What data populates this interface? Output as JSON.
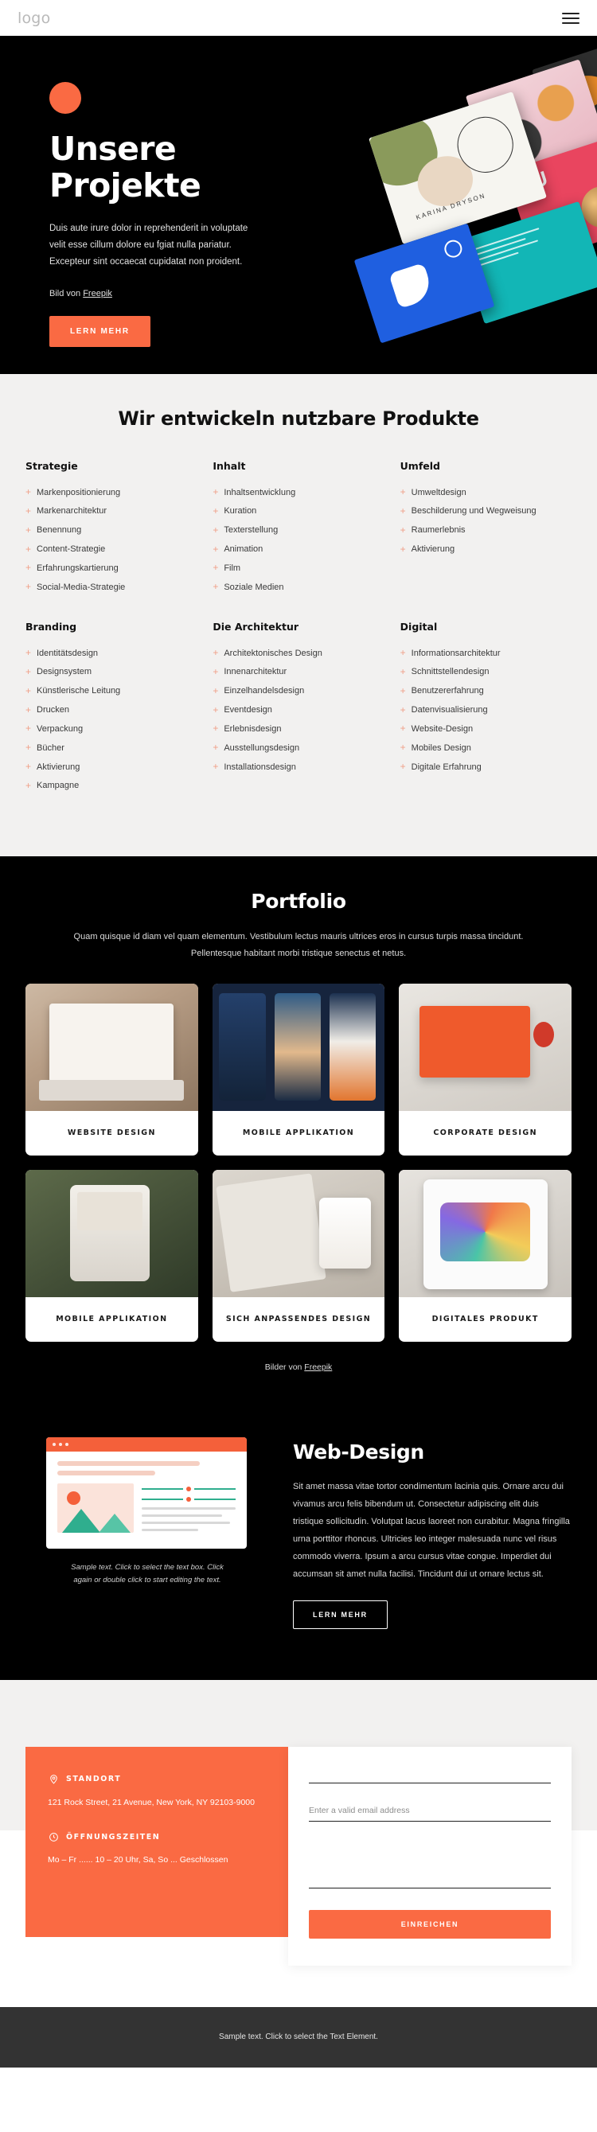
{
  "header": {
    "logo": "logo",
    "menu_icon": "hamburger-menu-icon"
  },
  "hero": {
    "title_line1": "Unsere",
    "title_line2": "Projekte",
    "paragraph": "Duis aute irure dolor in reprehenderit in voluptate velit esse cillum dolore eu fgiat nulla pariatur. Excepteur sint occaecat cupidatat non proident.",
    "credit_prefix": "Bild von ",
    "credit_link": "Freepik",
    "cta_label": "LERN MEHR",
    "accent_color": "#fa6a43",
    "background_color": "#000000"
  },
  "services": {
    "title": "Wir entwickeln nutzbare Produkte",
    "bullet_color": "#f0a088",
    "columns": [
      {
        "heading": "Strategie",
        "items": [
          "Markenpositionierung",
          "Markenarchitektur",
          "Benennung",
          "Content-Strategie",
          "Erfahrungskartierung",
          "Social-Media-Strategie"
        ]
      },
      {
        "heading": "Inhalt",
        "items": [
          "Inhaltsentwicklung",
          "Kuration",
          "Texterstellung",
          "Animation",
          "Film",
          "Soziale Medien"
        ]
      },
      {
        "heading": "Umfeld",
        "items": [
          "Umweltdesign",
          "Beschilderung und Wegweisung",
          "Raumerlebnis",
          "Aktivierung"
        ]
      },
      {
        "heading": "Branding",
        "items": [
          "Identitätsdesign",
          "Designsystem",
          "Künstlerische Leitung",
          "Drucken",
          "Verpackung",
          "Bücher",
          "Aktivierung",
          "Kampagne"
        ]
      },
      {
        "heading": "Die Architektur",
        "items": [
          "Architektonisches Design",
          "Innenarchitektur",
          "Einzelhandelsdesign",
          "Eventdesign",
          "Erlebnisdesign",
          "Ausstellungsdesign",
          "Installationsdesign"
        ]
      },
      {
        "heading": "Digital",
        "items": [
          "Informationsarchitektur",
          "Schnittstellendesign",
          "Benutzererfahrung",
          "Datenvisualisierung",
          "Website-Design",
          "Mobiles Design",
          "Digitale Erfahrung"
        ]
      }
    ]
  },
  "portfolio": {
    "title": "Portfolio",
    "lead": "Quam quisque id diam vel quam elementum. Vestibulum lectus mauris ultrices eros in cursus turpis massa tincidunt. Pellentesque habitant morbi tristique senectus et netus.",
    "cards": [
      {
        "label": "WEBSITE DESIGN"
      },
      {
        "label": "MOBILE APPLIKATION"
      },
      {
        "label": "CORPORATE DESIGN"
      },
      {
        "label": "MOBILE APPLIKATION"
      },
      {
        "label": "SICH ANPASSENDES DESIGN"
      },
      {
        "label": "DIGITALES PRODUKT"
      }
    ],
    "credit_prefix": "Bilder von ",
    "credit_link": "Freepik"
  },
  "webdesign": {
    "title": "Web-Design",
    "paragraph": "Sit amet massa vitae tortor condimentum lacinia quis. Ornare arcu dui vivamus arcu felis bibendum ut. Consectetur adipiscing elit duis tristique sollicitudin. Volutpat lacus laoreet non curabitur. Magna fringilla urna porttitor rhoncus. Ultricies leo integer malesuada nunc vel risus commodo viverra. Ipsum a arcu cursus vitae congue. Imperdiet dui accumsan sit amet nulla facilisi. Tincidunt dui ut ornare lectus sit.",
    "cta_label": "LERN MEHR",
    "caption": "Sample text. Click to select the text box. Click again or double click to start editing the text."
  },
  "contact": {
    "location": {
      "icon": "map-pin-icon",
      "title": "STANDORT",
      "address": "121 Rock Street, 21 Avenue, New York, NY 92103-9000"
    },
    "hours": {
      "icon": "clock-24-icon",
      "title": "ÖFFNUNGSZEITEN",
      "value": "Mo – Fr ...... 10 – 20 Uhr, Sa, So ... Geschlossen"
    },
    "form": {
      "name_placeholder": "",
      "email_placeholder": "Enter a valid email address",
      "message_placeholder": "",
      "submit_label": "EINREICHEN"
    },
    "accent_color": "#fa6a43"
  },
  "footer": {
    "text": "Sample text. Click to select the Text Element.",
    "background_color": "#333333"
  }
}
